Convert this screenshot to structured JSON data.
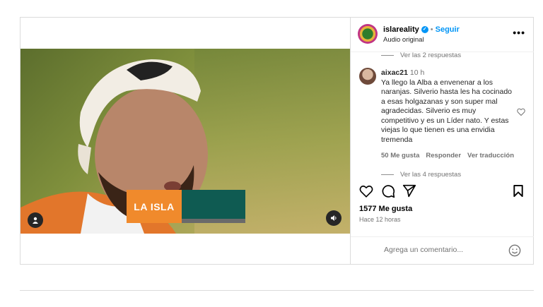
{
  "header": {
    "username": "islareality",
    "separator": "•",
    "follow_label": "Seguir",
    "audio": "Audio original",
    "more": "•••"
  },
  "media": {
    "overlay_text": "LA ISLA"
  },
  "comments": {
    "replies_top": "Ver las 2 respuestas",
    "user": "aixac21",
    "time": "10 h",
    "text": "Ya llego la Alba a envenenar a los naranjas. Silverio hasta les ha cocinado a esas holgazanas y son super mal agradecidas. Silverio es muy competitivo y es un Líder nato. Y estas viejas lo que tienen es una envidia tremenda",
    "likes": "50 Me gusta",
    "reply": "Responder",
    "translate": "Ver traducción",
    "replies_bottom": "Ver las 4 respuestas"
  },
  "post": {
    "likes": "1577 Me gusta",
    "ago": "Hace 12 horas"
  },
  "add_comment": {
    "placeholder": "Agrega un comentario..."
  },
  "colors": {
    "accent": "#0095f6",
    "tag_orange": "#f08a2c",
    "tag_teal": "#0f5b52"
  }
}
